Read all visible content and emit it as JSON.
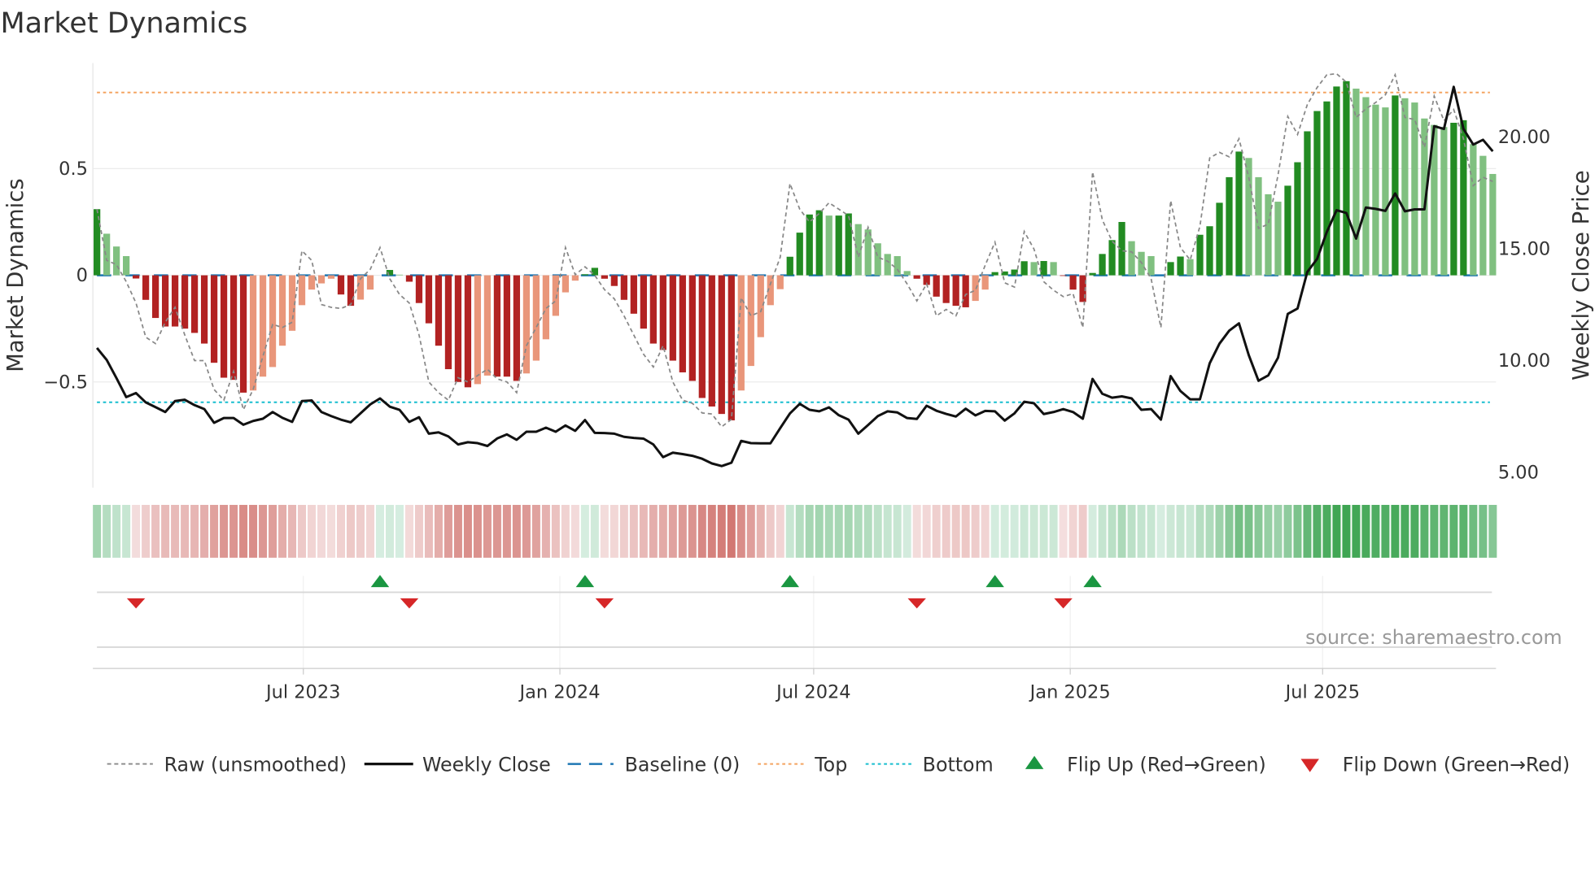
{
  "chart_data": {
    "type": "bar",
    "title": "Market Dynamics",
    "ylabel_left": "Market Dynamics",
    "ylabel_right": "Weekly Close Price",
    "x_start": "2023-02-03",
    "x_frequency": "weekly",
    "ylim_left": [
      -0.98,
      1.0
    ],
    "ylim_right": [
      4.0,
      24.0
    ],
    "left_ticks": [
      {
        "value": 0.5,
        "label": "0.5"
      },
      {
        "value": 0,
        "label": "0"
      },
      {
        "value": -0.5,
        "label": "−0.5"
      }
    ],
    "right_ticks": [
      {
        "value": 20,
        "label": "20.00"
      },
      {
        "value": 15,
        "label": "15.00"
      },
      {
        "value": 10,
        "label": "10.00"
      },
      {
        "value": 5,
        "label": "5.00"
      }
    ],
    "x_ticks": [
      {
        "date": "2023-07-01",
        "label": "Jul 2023"
      },
      {
        "date": "2024-01-01",
        "label": "Jan 2024"
      },
      {
        "date": "2024-07-01",
        "label": "Jul 2024"
      },
      {
        "date": "2025-01-01",
        "label": "Jan 2025"
      },
      {
        "date": "2025-07-01",
        "label": "Jul 2025"
      }
    ],
    "top_level": 0.857,
    "bottom_level": -0.595,
    "baseline": 0,
    "series": [
      {
        "name": "Market Dynamics (smoothed)",
        "kind": "bar",
        "values": [
          0.31,
          0.195,
          0.135,
          0.09,
          -0.015,
          -0.115,
          -0.2,
          -0.24,
          -0.24,
          -0.25,
          -0.27,
          -0.32,
          -0.41,
          -0.48,
          -0.49,
          -0.55,
          -0.54,
          -0.475,
          -0.43,
          -0.33,
          -0.26,
          -0.14,
          -0.067,
          -0.038,
          -0.016,
          -0.09,
          -0.143,
          -0.114,
          -0.067,
          0.0,
          0.025,
          0.003,
          -0.03,
          -0.13,
          -0.225,
          -0.33,
          -0.44,
          -0.5,
          -0.525,
          -0.51,
          -0.47,
          -0.475,
          -0.475,
          -0.495,
          -0.46,
          -0.4,
          -0.3,
          -0.19,
          -0.08,
          -0.025,
          0.005,
          0.035,
          -0.016,
          -0.05,
          -0.115,
          -0.18,
          -0.25,
          -0.32,
          -0.35,
          -0.4,
          -0.455,
          -0.495,
          -0.575,
          -0.615,
          -0.65,
          -0.68,
          -0.54,
          -0.425,
          -0.29,
          -0.14,
          -0.065,
          0.087,
          0.2,
          0.285,
          0.305,
          0.28,
          0.28,
          0.29,
          0.24,
          0.215,
          0.15,
          0.1,
          0.09,
          0.02,
          -0.016,
          -0.045,
          -0.1,
          -0.13,
          -0.143,
          -0.15,
          -0.12,
          -0.067,
          0.015,
          0.018,
          0.027,
          0.066,
          0.062,
          0.067,
          0.062,
          -0.003,
          -0.067,
          -0.125,
          0.011,
          0.1,
          0.165,
          0.25,
          0.16,
          0.11,
          0.09,
          0.0,
          0.062,
          0.088,
          0.076,
          0.19,
          0.23,
          0.34,
          0.46,
          0.58,
          0.55,
          0.46,
          0.38,
          0.345,
          0.42,
          0.53,
          0.675,
          0.77,
          0.815,
          0.885,
          0.91,
          0.875,
          0.835,
          0.8,
          0.787,
          0.843,
          0.83,
          0.81,
          0.735,
          0.705,
          0.695,
          0.715,
          0.727,
          0.615,
          0.56,
          0.475
        ]
      },
      {
        "name": "Raw (unsmoothed)",
        "kind": "line",
        "values": [
          0.31,
          0.07,
          0.05,
          -0.03,
          -0.13,
          -0.29,
          -0.32,
          -0.22,
          -0.15,
          -0.28,
          -0.4,
          -0.4,
          -0.535,
          -0.585,
          -0.45,
          -0.63,
          -0.535,
          -0.38,
          -0.23,
          -0.245,
          -0.22,
          0.115,
          0.07,
          -0.137,
          -0.15,
          -0.155,
          -0.137,
          -0.016,
          0.028,
          0.13,
          -0.016,
          -0.09,
          -0.13,
          -0.28,
          -0.5,
          -0.55,
          -0.585,
          -0.48,
          -0.5,
          -0.47,
          -0.44,
          -0.485,
          -0.5,
          -0.55,
          -0.33,
          -0.245,
          -0.155,
          -0.12,
          0.13,
          0.003,
          0.04,
          0.0,
          -0.067,
          -0.11,
          -0.19,
          -0.28,
          -0.37,
          -0.43,
          -0.33,
          -0.5,
          -0.585,
          -0.6,
          -0.645,
          -0.65,
          -0.71,
          -0.675,
          -0.105,
          -0.19,
          -0.17,
          -0.04,
          0.085,
          0.43,
          0.31,
          0.25,
          0.29,
          0.34,
          0.31,
          0.28,
          0.085,
          0.225,
          0.085,
          0.066,
          0.028,
          -0.04,
          -0.12,
          -0.04,
          -0.19,
          -0.16,
          -0.19,
          -0.09,
          -0.07,
          0.047,
          0.155,
          -0.035,
          -0.055,
          0.205,
          0.123,
          -0.03,
          -0.07,
          -0.1,
          -0.086,
          -0.245,
          0.485,
          0.26,
          0.16,
          0.115,
          0.11,
          0.06,
          -0.016,
          -0.245,
          0.35,
          0.13,
          0.072,
          0.23,
          0.55,
          0.576,
          0.555,
          0.64,
          0.46,
          0.22,
          0.24,
          0.47,
          0.745,
          0.66,
          0.8,
          0.88,
          0.94,
          0.945,
          0.905,
          0.74,
          0.78,
          0.81,
          0.846,
          0.94,
          0.74,
          0.73,
          0.6,
          0.84,
          0.725,
          0.777,
          0.64,
          0.42,
          0.46,
          0.44
        ]
      },
      {
        "name": "Weekly Close",
        "kind": "line",
        "axis": "right",
        "values": [
          10.57,
          10.03,
          9.22,
          8.37,
          8.55,
          8.13,
          7.92,
          7.7,
          8.19,
          8.25,
          8.01,
          7.83,
          7.22,
          7.43,
          7.43,
          7.13,
          7.3,
          7.4,
          7.7,
          7.44,
          7.26,
          8.19,
          8.22,
          7.7,
          7.52,
          7.36,
          7.24,
          7.64,
          8.04,
          8.31,
          7.94,
          7.8,
          7.26,
          7.47,
          6.73,
          6.79,
          6.61,
          6.25,
          6.35,
          6.31,
          6.18,
          6.52,
          6.7,
          6.46,
          6.82,
          6.82,
          7.0,
          6.82,
          7.1,
          6.86,
          7.34,
          6.77,
          6.76,
          6.73,
          6.59,
          6.54,
          6.51,
          6.25,
          5.68,
          5.88,
          5.82,
          5.74,
          5.61,
          5.4,
          5.28,
          5.43,
          6.41,
          6.31,
          6.3,
          6.3,
          6.98,
          7.64,
          8.07,
          7.8,
          7.73,
          7.91,
          7.56,
          7.36,
          6.73,
          7.12,
          7.52,
          7.73,
          7.68,
          7.43,
          7.39,
          7.98,
          7.76,
          7.62,
          7.5,
          7.85,
          7.55,
          7.75,
          7.73,
          7.32,
          7.64,
          8.16,
          8.09,
          7.61,
          7.7,
          7.83,
          7.7,
          7.4,
          9.18,
          8.52,
          8.34,
          8.4,
          8.31,
          7.8,
          7.83,
          7.36,
          9.31,
          8.64,
          8.27,
          8.27,
          9.88,
          10.76,
          11.34,
          11.67,
          10.25,
          9.1,
          9.34,
          10.13,
          12.09,
          12.33,
          13.97,
          14.55,
          15.76,
          16.73,
          16.61,
          15.46,
          16.85,
          16.79,
          16.7,
          17.48,
          16.68,
          16.77,
          16.77,
          20.49,
          20.37,
          22.25,
          20.37,
          19.67,
          19.88,
          19.37
        ]
      }
    ],
    "flip_up_weeks": [
      29,
      50,
      71,
      92,
      102
    ],
    "flip_down_weeks": [
      4,
      32,
      52,
      84,
      99
    ],
    "colors": {
      "up_strong": "#228b22",
      "up_weak": "#80c080",
      "down_strong": "#b22222",
      "down_weak": "#e9967a",
      "raw": "#888888",
      "close": "#111111",
      "baseline": "#1f77b4",
      "top": "#f4a460",
      "bottom": "#17becf",
      "flip_up": "#1a9641",
      "flip_down": "#d62728"
    },
    "legend": {
      "placement": "bottom",
      "items": [
        {
          "label": "Raw (unsmoothed)",
          "kind": "raw"
        },
        {
          "label": "Weekly Close",
          "kind": "close"
        },
        {
          "label": "Baseline (0)",
          "kind": "baseline"
        },
        {
          "label": "Top",
          "kind": "top"
        },
        {
          "label": "Bottom",
          "kind": "bottom"
        },
        {
          "label": "Flip Up (Red→Green)",
          "kind": "flip_up"
        },
        {
          "label": "Flip Down (Green→Red)",
          "kind": "flip_down"
        }
      ]
    },
    "annotation": "source: sharemaestro.com"
  }
}
